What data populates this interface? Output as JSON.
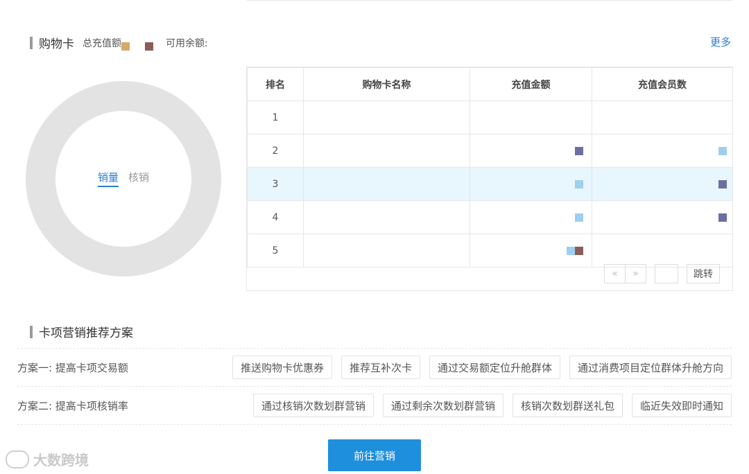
{
  "card_section": {
    "title": "购物卡",
    "total_recharge_label": "总充值额",
    "available_balance_label": "可用余额:",
    "more_link": "更多",
    "legend_colors": [
      "#d4a96a",
      "#8a5e57"
    ]
  },
  "donut": {
    "tabs": [
      {
        "label": "销量",
        "active": true
      },
      {
        "label": "核销",
        "active": false
      }
    ],
    "ring_color": "#e3e3e3"
  },
  "ranking_table": {
    "headers": [
      "排名",
      "购物卡名称",
      "充值金额",
      "充值会员数"
    ],
    "rows": [
      {
        "rank": "1",
        "selected": false
      },
      {
        "rank": "2",
        "selected": false
      },
      {
        "rank": "3",
        "selected": true
      },
      {
        "rank": "4",
        "selected": false
      },
      {
        "rank": "5",
        "selected": false
      }
    ],
    "pager": {
      "prev": "«",
      "next": "»",
      "jump_label": "跳转"
    }
  },
  "marketing": {
    "title": "卡项营销推荐方案",
    "plans": [
      {
        "label": "方案一: 提高卡项交易额",
        "actions": [
          "推送购物卡优惠券",
          "推荐互补次卡",
          "通过交易额定位升舱群体",
          "通过消费项目定位群体升舱方向"
        ]
      },
      {
        "label": "方案二: 提高卡项核销率",
        "actions": [
          "通过核销次数划群营销",
          "通过剩余次数划群营销",
          "核销次数划群送礼包",
          "临近失效即时通知"
        ]
      }
    ],
    "go_button": "前往营销"
  },
  "watermark": {
    "text": "大数跨境"
  },
  "colors": {
    "accent": "#1e8fdc",
    "link": "#2a7ed2",
    "selected_row": "#e8f6fd"
  }
}
